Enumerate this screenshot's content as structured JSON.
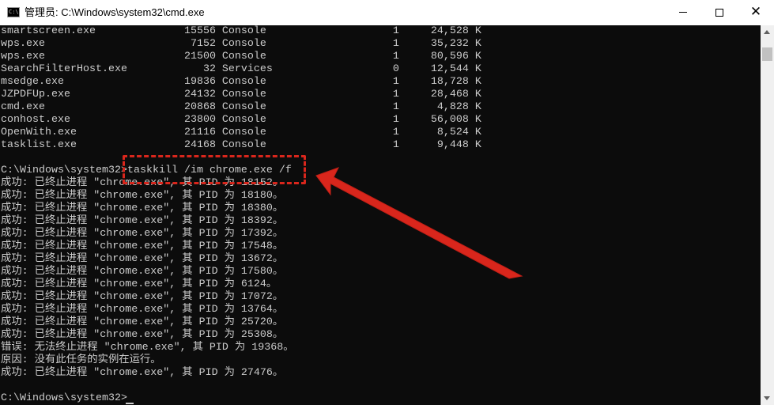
{
  "window": {
    "icon_text": "C:\\",
    "title": "管理员: C:\\Windows\\system32\\cmd.exe",
    "minimize_glyph": "",
    "maximize_glyph": "",
    "close_glyph": "✕"
  },
  "console": {
    "lines": [
      "smartscreen.exe              15556 Console                    1     24,528 K",
      "wps.exe                       7152 Console                    1     35,232 K",
      "wps.exe                      21500 Console                    1     80,596 K",
      "SearchFilterHost.exe            32 Services                   0     12,544 K",
      "msedge.exe                   19836 Console                    1     18,728 K",
      "JZPDFUp.exe                  24132 Console                    1     28,468 K",
      "cmd.exe                      20868 Console                    1      4,828 K",
      "conhost.exe                  23800 Console                    1     56,008 K",
      "OpenWith.exe                 21116 Console                    1      8,524 K",
      "tasklist.exe                 24168 Console                    1      9,448 K",
      "",
      "C:\\Windows\\system32>taskkill /im chrome.exe /f",
      "成功: 已终止进程 \"chrome.exe\", 其 PID 为 18152。",
      "成功: 已终止进程 \"chrome.exe\", 其 PID 为 18180。",
      "成功: 已终止进程 \"chrome.exe\", 其 PID 为 18380。",
      "成功: 已终止进程 \"chrome.exe\", 其 PID 为 18392。",
      "成功: 已终止进程 \"chrome.exe\", 其 PID 为 17392。",
      "成功: 已终止进程 \"chrome.exe\", 其 PID 为 17548。",
      "成功: 已终止进程 \"chrome.exe\", 其 PID 为 13672。",
      "成功: 已终止进程 \"chrome.exe\", 其 PID 为 17580。",
      "成功: 已终止进程 \"chrome.exe\", 其 PID 为 6124。",
      "成功: 已终止进程 \"chrome.exe\", 其 PID 为 17072。",
      "成功: 已终止进程 \"chrome.exe\", 其 PID 为 13764。",
      "成功: 已终止进程 \"chrome.exe\", 其 PID 为 25720。",
      "成功: 已终止进程 \"chrome.exe\", 其 PID 为 25308。",
      "错误: 无法终止进程 \"chrome.exe\", 其 PID 为 19368。",
      "原因: 没有此任务的实例在运行。",
      "成功: 已终止进程 \"chrome.exe\", 其 PID 为 27476。",
      "",
      "C:\\Windows\\system32>"
    ]
  },
  "colors": {
    "console_bg": "#0c0c0c",
    "console_text": "#cccccc",
    "annotation_red": "#d9261c"
  }
}
